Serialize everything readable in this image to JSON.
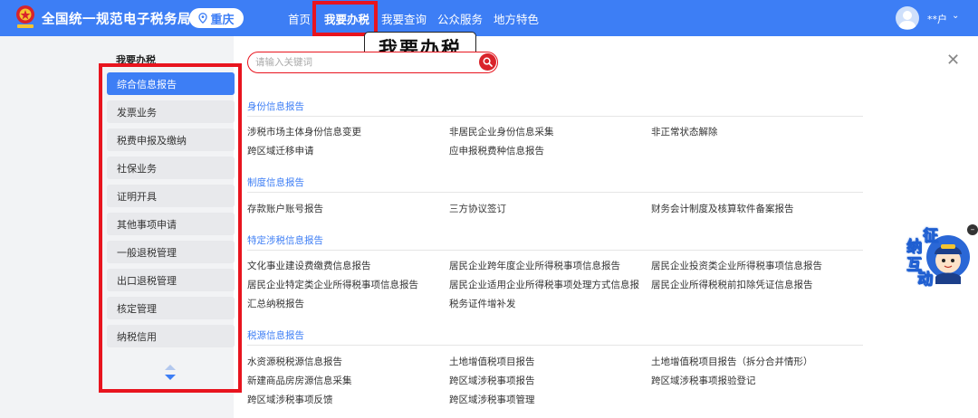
{
  "header": {
    "app_title": "全国统一规范电子税务局",
    "region": "重庆",
    "nav": [
      "首页",
      "我要办税",
      "我要查询",
      "公众服务",
      "地方特色"
    ],
    "active_nav_index": 1,
    "user_name": "**户",
    "callout_text": "我要办税"
  },
  "sidebar": {
    "title": "我要办税",
    "items": [
      "综合信息报告",
      "发票业务",
      "税费申报及缴纳",
      "社保业务",
      "证明开具",
      "其他事项申请",
      "一般退税管理",
      "出口退税管理",
      "核定管理",
      "纳税信用"
    ],
    "active_index": 0
  },
  "search": {
    "placeholder": "请输入关键词"
  },
  "sections": [
    {
      "title": "身份信息报告",
      "links": [
        [
          "涉税市场主体身份信息变更",
          "非居民企业身份信息采集",
          "非正常状态解除"
        ],
        [
          "跨区域迁移申请",
          "应申报税费种信息报告"
        ]
      ]
    },
    {
      "title": "制度信息报告",
      "links": [
        [
          "存款账户账号报告",
          "三方协议签订",
          "财务会计制度及核算软件备案报告"
        ]
      ]
    },
    {
      "title": "特定涉税信息报告",
      "links": [
        [
          "文化事业建设费缴费信息报告",
          "居民企业跨年度企业所得税事项信息报告",
          "居民企业投资类企业所得税事项信息报告"
        ],
        [
          "居民企业特定类企业所得税事项信息报告",
          "居民企业适用企业所得税事项处理方式信息报...",
          "居民企业所得税税前扣除凭证信息报告"
        ],
        [
          "汇总纳税报告",
          "税务证件增补发"
        ]
      ]
    },
    {
      "title": "税源信息报告",
      "links": [
        [
          "水资源税税源信息报告",
          "土地增值税项目报告",
          "土地增值税项目报告（拆分合并情形）"
        ],
        [
          "新建商品房房源信息采集",
          "跨区域涉税事项报告",
          "跨区域涉税事项报验登记"
        ],
        [
          "跨区域涉税事项反馈",
          "跨区域涉税事项管理"
        ]
      ]
    }
  ],
  "float_widget": {
    "chars": [
      "征",
      "纳",
      "互",
      "动"
    ]
  },
  "colors": {
    "brand_blue": "#3d7ef5",
    "highlight_red": "#e8141e",
    "sidebar_bg": "#f2f3f5"
  }
}
